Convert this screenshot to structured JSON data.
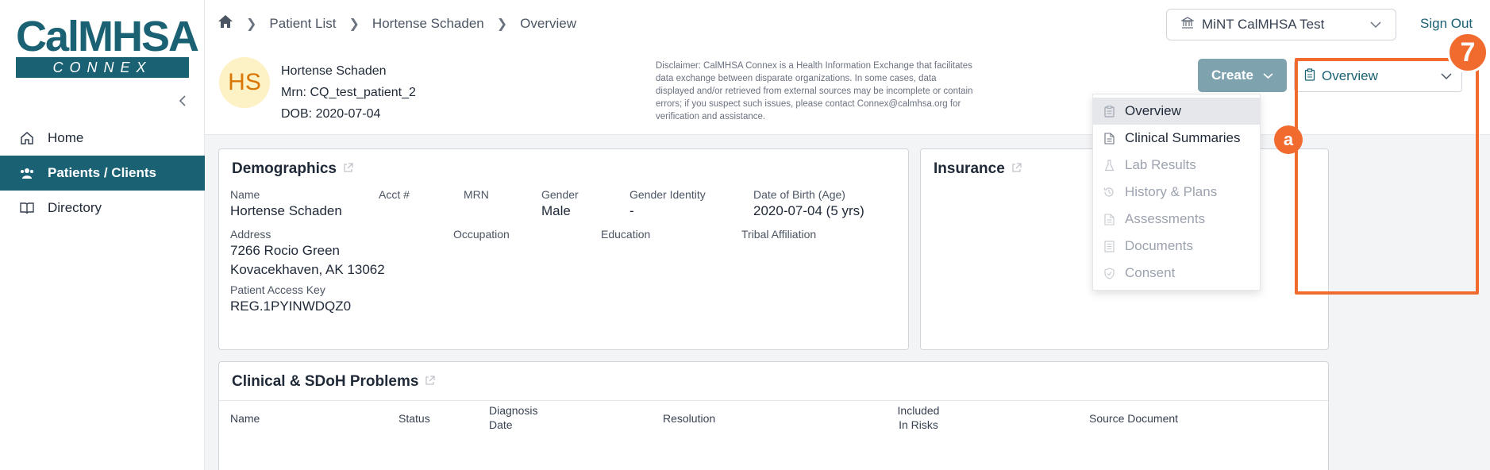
{
  "brand": {
    "logo_top": "CalMHSA",
    "logo_bottom": "CONNEX"
  },
  "sidebar": {
    "items": [
      {
        "label": "Home",
        "icon": "home-icon"
      },
      {
        "label": "Patients / Clients",
        "icon": "users-icon",
        "active": true
      },
      {
        "label": "Directory",
        "icon": "book-icon"
      }
    ]
  },
  "breadcrumb": [
    "Patient List",
    "Hortense Schaden",
    "Overview"
  ],
  "org_select": {
    "label": "MiNT CalMHSA Test"
  },
  "signout_label": "Sign Out",
  "patient": {
    "initials": "HS",
    "name": "Hortense Schaden",
    "mrn": "Mrn: CQ_test_patient_2",
    "dob": "DOB: 2020-07-04"
  },
  "disclaimer": "Disclaimer: CalMHSA Connex is a Health Information Exchange that facilitates data exchange between disparate organizations. In some cases, data displayed and/or retrieved from external sources may be incomplete or contain errors; if you suspect such issues, please contact Connex@calmhsa.org for verification and assistance.",
  "create_label": "Create",
  "view_select": {
    "current": "Overview",
    "options": [
      {
        "label": "Overview",
        "icon": "clipboard-icon",
        "state": "selected"
      },
      {
        "label": "Clinical Summaries",
        "icon": "document-icon",
        "state": "enabled"
      },
      {
        "label": "Lab Results",
        "icon": "flask-icon",
        "state": "disabled"
      },
      {
        "label": "History & Plans",
        "icon": "history-icon",
        "state": "disabled"
      },
      {
        "label": "Assessments",
        "icon": "file-icon",
        "state": "disabled"
      },
      {
        "label": "Documents",
        "icon": "docs-icon",
        "state": "disabled"
      },
      {
        "label": "Consent",
        "icon": "shield-icon",
        "state": "disabled"
      }
    ]
  },
  "annotations": {
    "step_number": "7",
    "item_marker": "a",
    "accent": "#f26b2e"
  },
  "demographics": {
    "title": "Demographics",
    "fields": {
      "name": {
        "label": "Name",
        "value": "Hortense Schaden"
      },
      "acct": {
        "label": "Acct #",
        "value": ""
      },
      "mrn": {
        "label": "MRN",
        "value": ""
      },
      "gender": {
        "label": "Gender",
        "value": "Male"
      },
      "gender_identity": {
        "label": "Gender Identity",
        "value": "-"
      },
      "dob_age": {
        "label": "Date of Birth (Age)",
        "value": "2020-07-04 (5 yrs)"
      },
      "address": {
        "label": "Address",
        "line1": "7266 Rocio Green",
        "line2": "Kovacekhaven, AK 13062"
      },
      "occupation": {
        "label": "Occupation",
        "value": ""
      },
      "education": {
        "label": "Education",
        "value": ""
      },
      "tribal": {
        "label": "Tribal Affiliation",
        "value": ""
      },
      "access_key": {
        "label": "Patient Access Key",
        "value": "REG.1PYINWDQZ0"
      }
    }
  },
  "insurance": {
    "title": "Insurance"
  },
  "problems": {
    "title": "Clinical & SDoH Problems",
    "columns": [
      "Name",
      "Status",
      "Diagnosis Date",
      "Resolution",
      "Included In Risks",
      "Source Document"
    ]
  },
  "colors": {
    "primary": "#1b6174",
    "create_button": "#7ea3ae",
    "avatar_bg": "#fdf1c6",
    "avatar_text": "#d97706"
  }
}
